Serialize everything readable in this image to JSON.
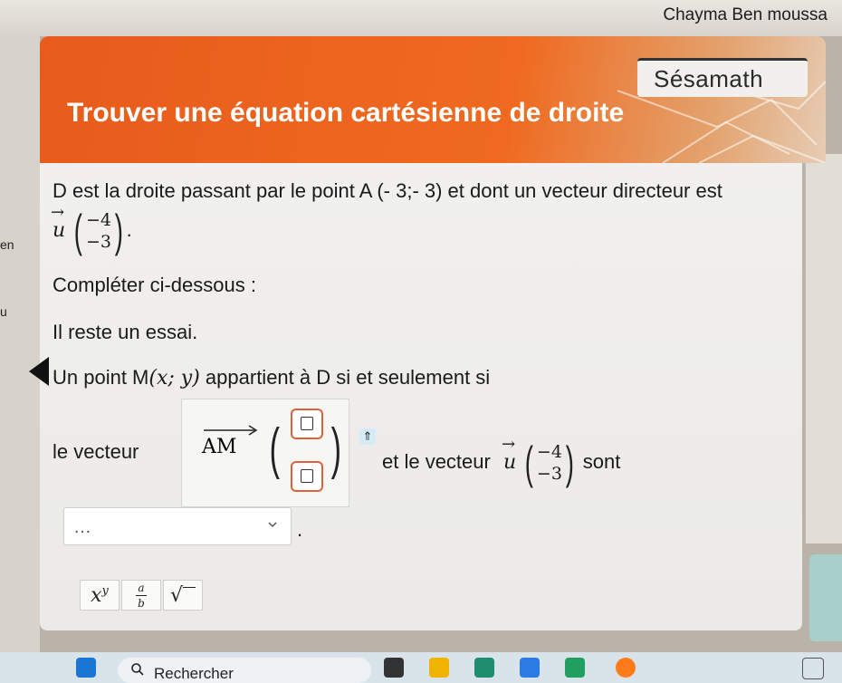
{
  "user": {
    "name": "Chayma Ben moussa"
  },
  "left_strip_labels": [
    "en",
    "u"
  ],
  "header": {
    "brand": "Sésamath",
    "title": "Trouver une équation cartésienne de droite"
  },
  "content": {
    "statement_line1": "D est la droite passant par le point A (- 3;- 3) et dont un vecteur directeur est",
    "vector_u": {
      "name": "u",
      "x": "−4",
      "y": "−3"
    },
    "instruction": "Compléter ci-dessous :",
    "attempts": "Il reste un essai.",
    "condition_prefix": "Un point M",
    "condition_coords": "(x; y)",
    "condition_suffix": " appartient à D si et seulement si",
    "le_vecteur": "le vecteur",
    "vector_am": "AM",
    "et_le_vecteur": "et le vecteur",
    "sont": "sont",
    "dropdown": {
      "value": "…"
    },
    "period": "."
  },
  "toolbar": {
    "power_label": "x",
    "power_exp": "y",
    "fraction_num": "a",
    "fraction_den": "b",
    "sqrt_label": "√"
  },
  "taskbar": {
    "search_label": "Rechercher"
  }
}
